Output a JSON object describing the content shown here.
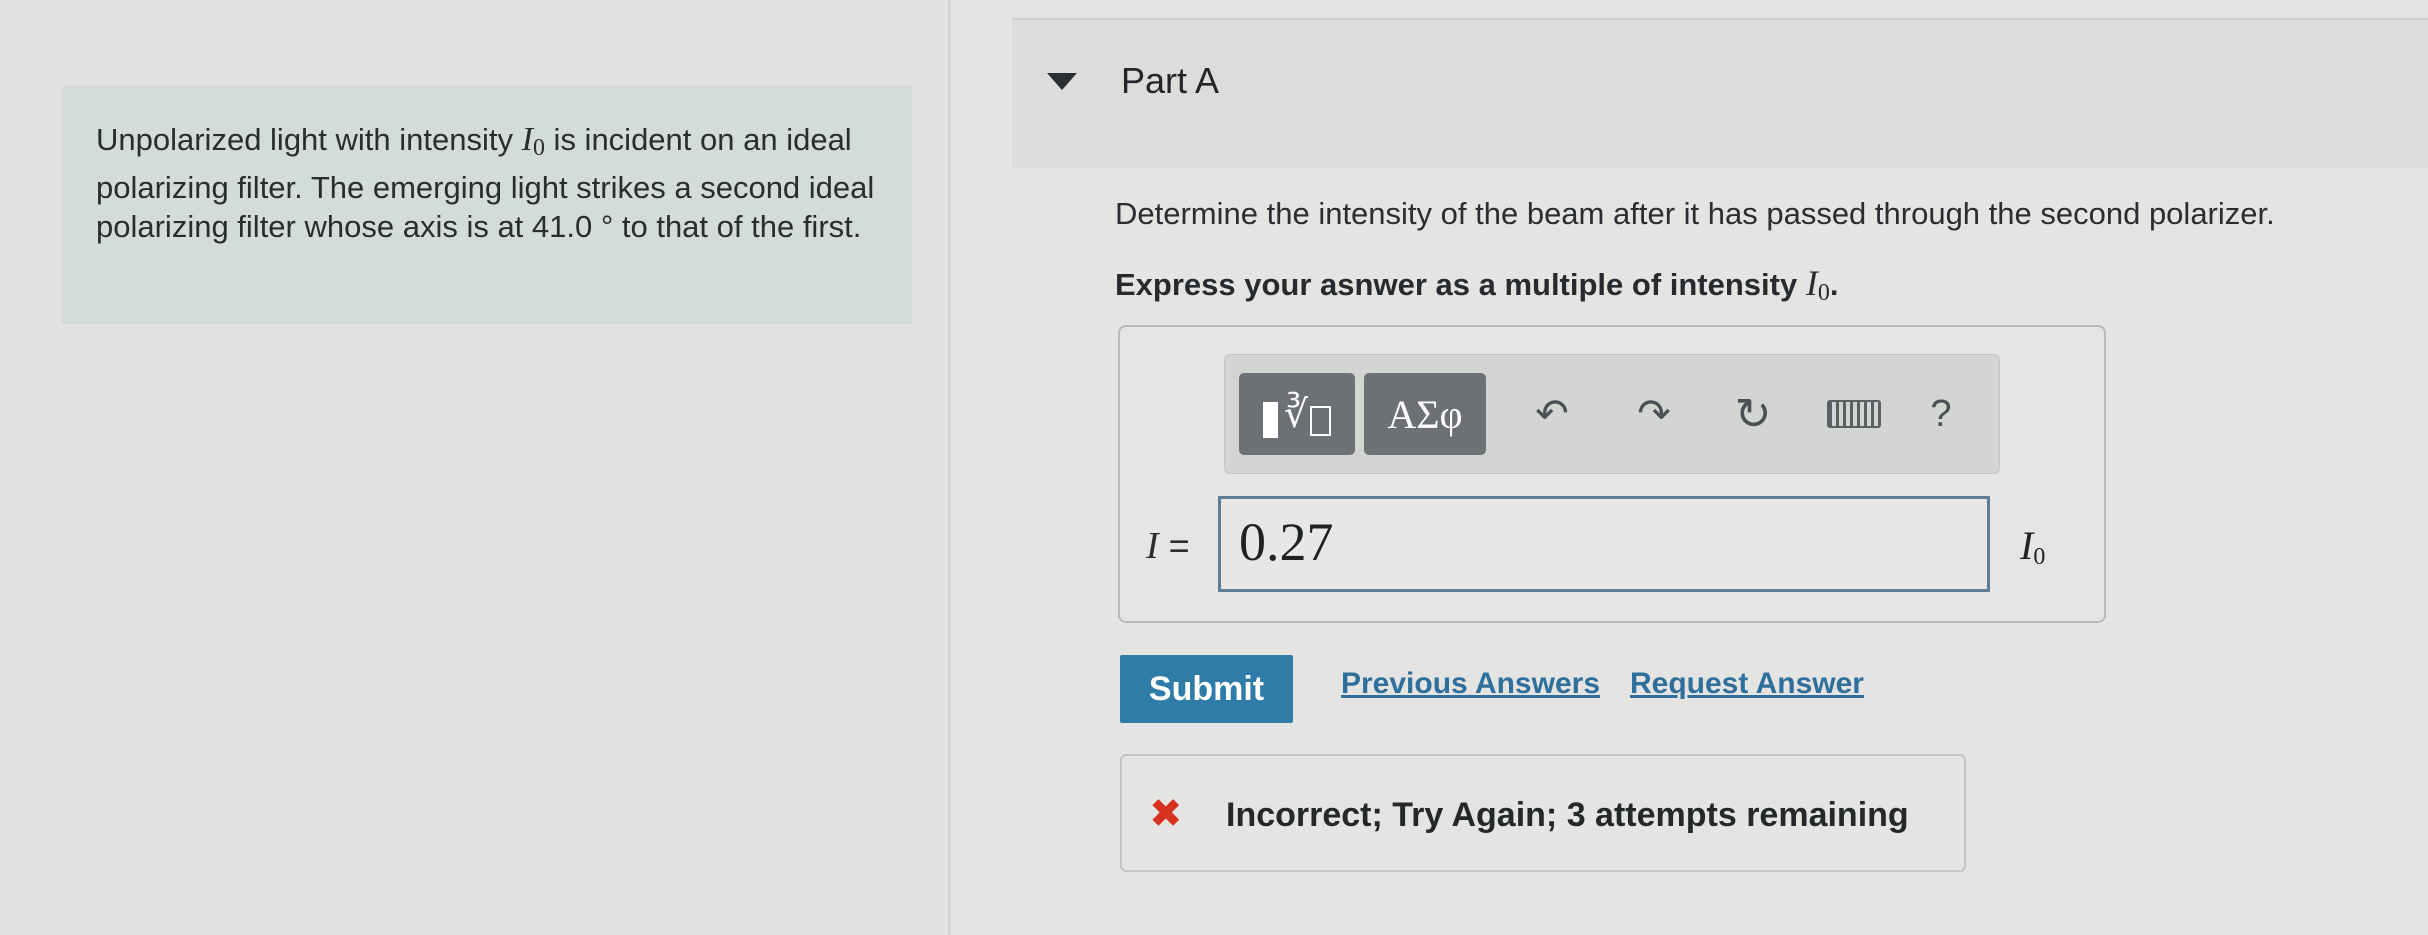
{
  "problem": {
    "text_part1": "Unpolarized light with intensity ",
    "intensity_symbol": "I",
    "intensity_subscript": "0",
    "text_part2": " is incident on an ideal polarizing filter. The emerging light strikes a second ideal polarizing filter whose axis is at 41.0 ° to that of the first."
  },
  "part": {
    "title": "Part A",
    "question": "Determine the intensity of the beam after it has passed through the second polarizer.",
    "instruction_prefix": "Express your asnwer as a multiple of intensity ",
    "instruction_symbol": "I",
    "instruction_subscript": "0",
    "instruction_suffix": "."
  },
  "toolbar": {
    "template_symbol": "∛",
    "greek_label": "ΑΣφ",
    "undo_glyph": "↶",
    "redo_glyph": "↷",
    "reset_glyph": "↻",
    "help_label": "?"
  },
  "answer": {
    "variable": "I",
    "equals": "=",
    "value": "0.27",
    "unit_symbol": "I",
    "unit_subscript": "0"
  },
  "actions": {
    "submit_label": "Submit",
    "previous_answers_label": "Previous Answers",
    "request_answer_label": "Request Answer"
  },
  "feedback": {
    "icon_glyph": "✖",
    "message": "Incorrect; Try Again; 3 attempts remaining",
    "color": "#d7321f"
  },
  "colors": {
    "submit_bg": "#2f7ca8",
    "link": "#2f6f9c",
    "input_border": "#5f7d92"
  }
}
